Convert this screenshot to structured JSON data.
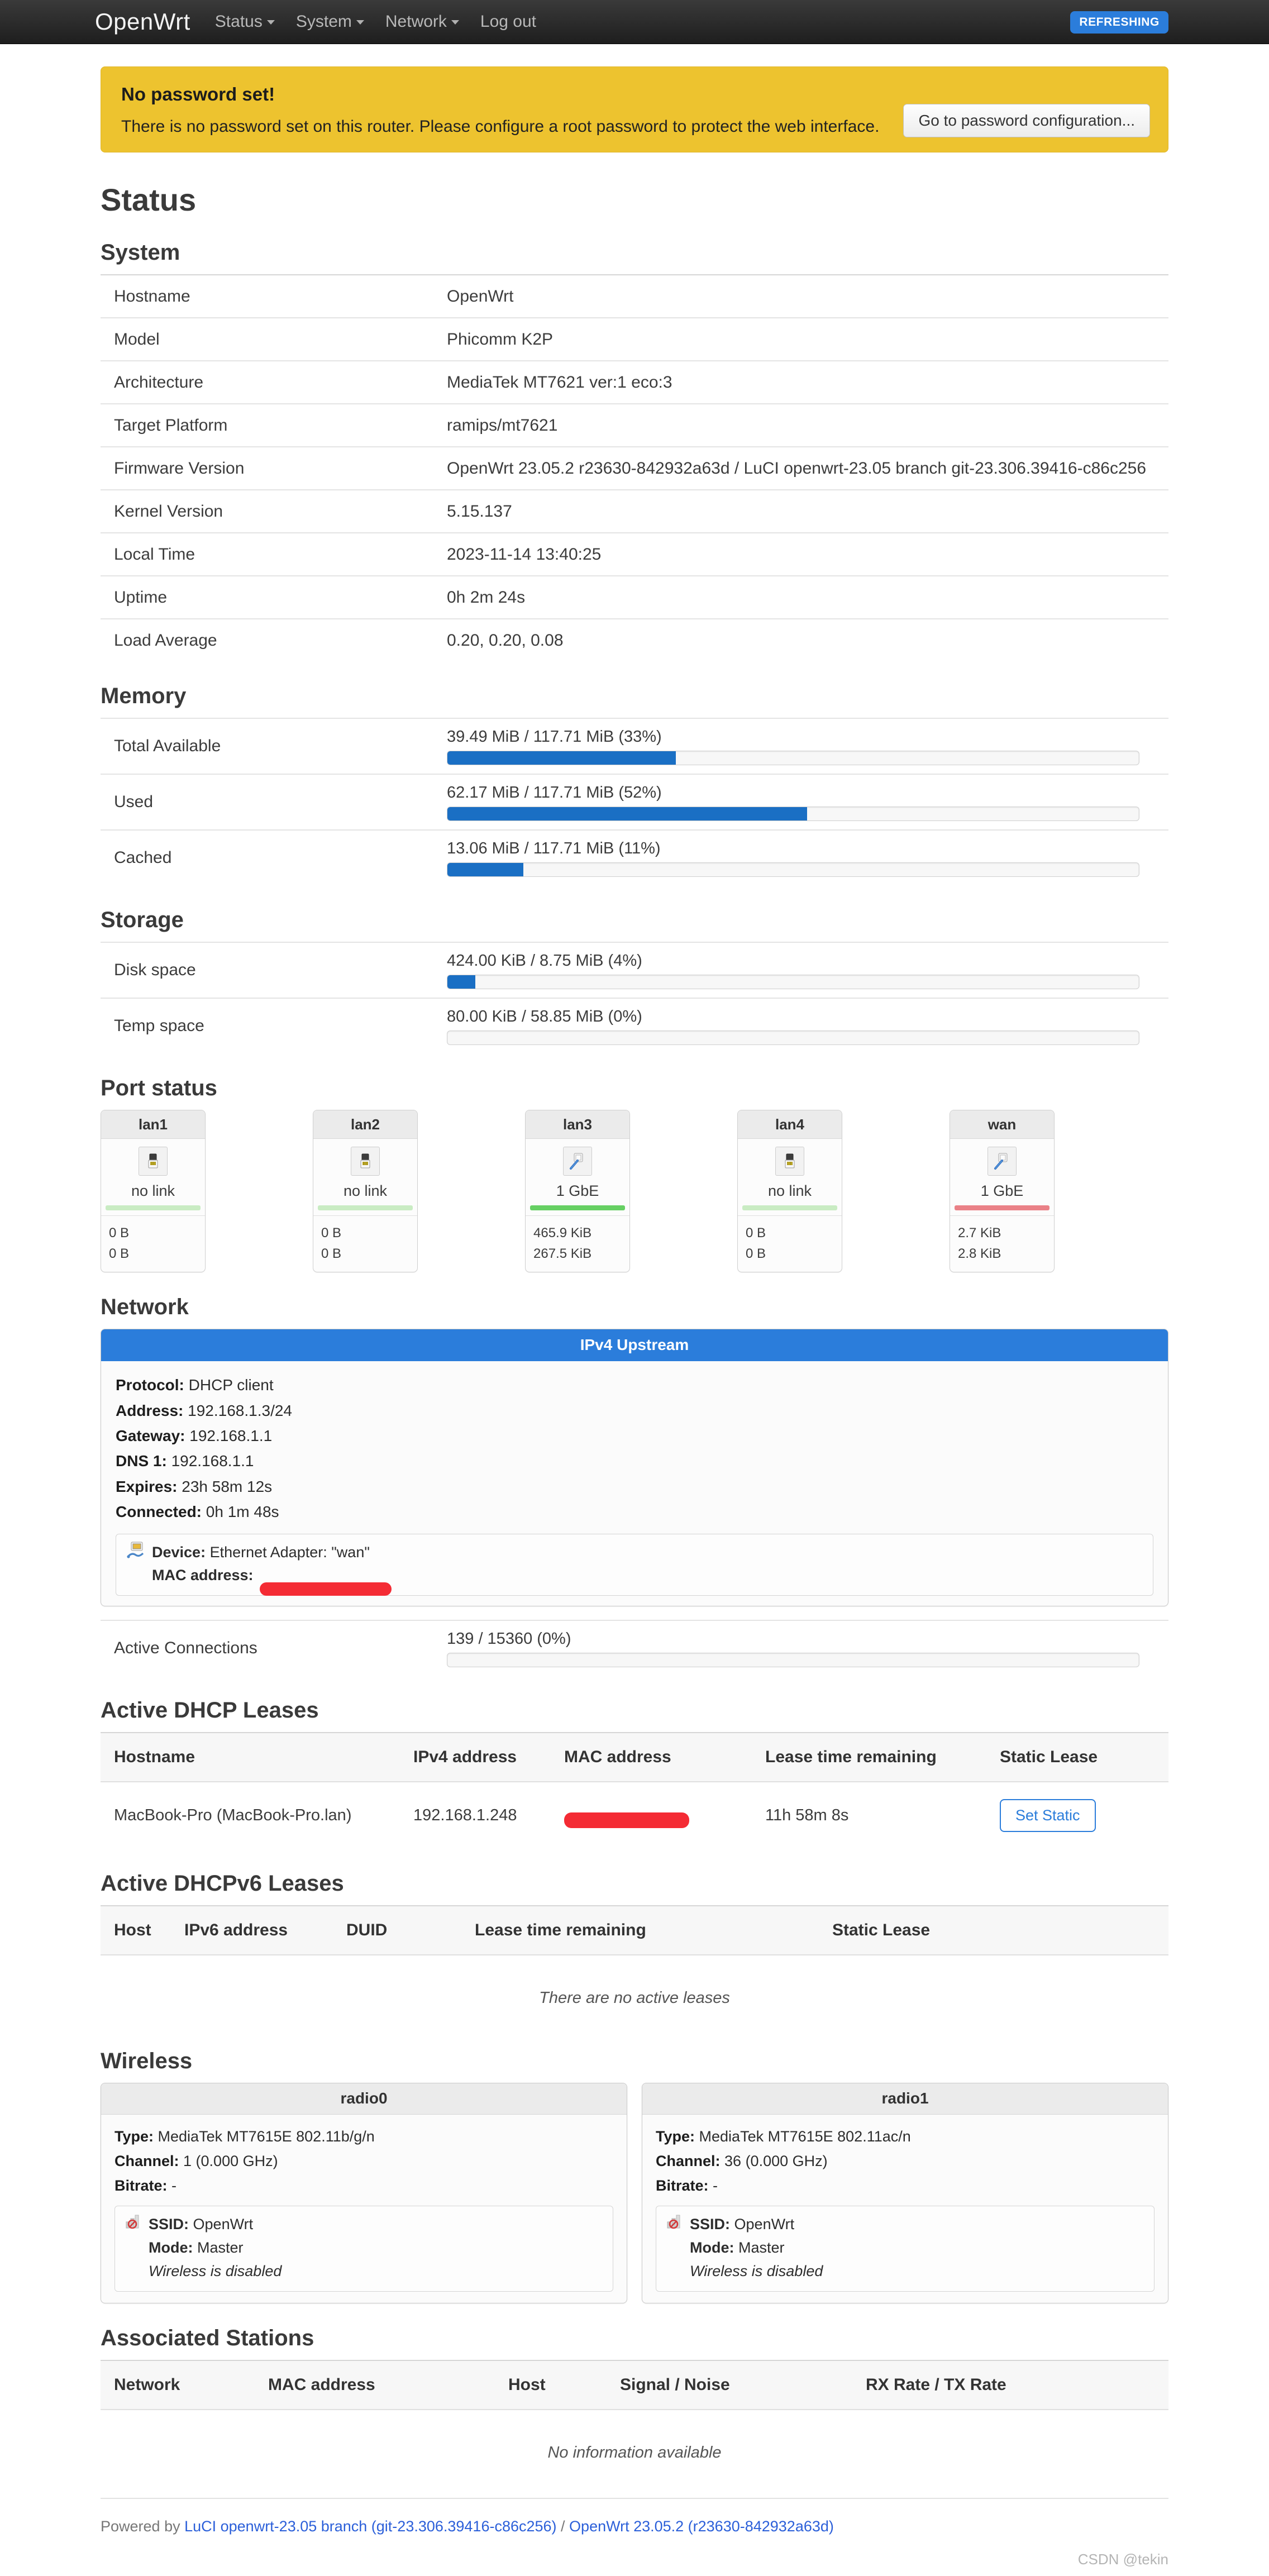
{
  "nav": {
    "brand": "OpenWrt",
    "items": [
      {
        "label": "Status",
        "has_caret": true
      },
      {
        "label": "System",
        "has_caret": true
      },
      {
        "label": "Network",
        "has_caret": true
      },
      {
        "label": "Log out",
        "has_caret": false
      }
    ],
    "refresh_badge": "REFRESHING",
    "badge_color": "#2b7ddb"
  },
  "alert": {
    "title": "No password set!",
    "text": "There is no password set on this router. Please configure a root password to protect the web interface.",
    "button": "Go to password configuration...",
    "bg_color": "#edc32f"
  },
  "page_title": "Status",
  "system": {
    "heading": "System",
    "rows": [
      {
        "key": "Hostname",
        "value": "OpenWrt"
      },
      {
        "key": "Model",
        "value": "Phicomm K2P"
      },
      {
        "key": "Architecture",
        "value": "MediaTek MT7621 ver:1 eco:3"
      },
      {
        "key": "Target Platform",
        "value": "ramips/mt7621"
      },
      {
        "key": "Firmware Version",
        "value": "OpenWrt 23.05.2 r23630-842932a63d / LuCI openwrt-23.05 branch git-23.306.39416-c86c256"
      },
      {
        "key": "Kernel Version",
        "value": "5.15.137"
      },
      {
        "key": "Local Time",
        "value": "2023-11-14 13:40:25"
      },
      {
        "key": "Uptime",
        "value": "0h 2m 24s"
      },
      {
        "key": "Load Average",
        "value": "0.20, 0.20, 0.08"
      }
    ]
  },
  "memory": {
    "heading": "Memory",
    "rows": [
      {
        "key": "Total Available",
        "label": "39.49 MiB / 117.71 MiB (33%)",
        "percent": 33
      },
      {
        "key": "Used",
        "label": "62.17 MiB / 117.71 MiB (52%)",
        "percent": 52
      },
      {
        "key": "Cached",
        "label": "13.06 MiB / 117.71 MiB (11%)",
        "percent": 11
      }
    ]
  },
  "storage": {
    "heading": "Storage",
    "rows": [
      {
        "key": "Disk space",
        "label": "424.00 KiB / 8.75 MiB (4%)",
        "percent": 4
      },
      {
        "key": "Temp space",
        "label": "80.00 KiB / 58.85 MiB (0%)",
        "percent": 0
      }
    ]
  },
  "port_status": {
    "heading": "Port status",
    "ports": [
      {
        "name": "lan1",
        "speed": "no link",
        "linked": false,
        "accent": "#c9ecc3",
        "rx": "0 B",
        "tx": "0 B"
      },
      {
        "name": "lan2",
        "speed": "no link",
        "linked": false,
        "accent": "#c9ecc3",
        "rx": "0 B",
        "tx": "0 B"
      },
      {
        "name": "lan3",
        "speed": "1 GbE",
        "linked": true,
        "accent": "#66d063",
        "rx": "465.9 KiB",
        "tx": "267.5 KiB"
      },
      {
        "name": "lan4",
        "speed": "no link",
        "linked": false,
        "accent": "#c9ecc3",
        "rx": "0 B",
        "tx": "0 B"
      },
      {
        "name": "wan",
        "speed": "1 GbE",
        "linked": true,
        "accent": "#ea8187",
        "rx": "2.7 KiB",
        "tx": "2.8 KiB"
      }
    ]
  },
  "network": {
    "heading": "Network",
    "upstream": {
      "title": "IPv4 Upstream",
      "title_bg": "#2b7ddb",
      "lines": [
        {
          "label": "Protocol:",
          "value": "DHCP client"
        },
        {
          "label": "Address:",
          "value": "192.168.1.3/24"
        },
        {
          "label": "Gateway:",
          "value": "192.168.1.1"
        },
        {
          "label": "DNS 1:",
          "value": "192.168.1.1"
        },
        {
          "label": "Expires:",
          "value": "23h 58m 12s"
        },
        {
          "label": "Connected:",
          "value": "0h 1m 48s"
        }
      ],
      "device_label": "Device:",
      "device_value": "Ethernet Adapter: \"wan\"",
      "mac_label": "MAC address:",
      "mac_value": "",
      "mac_redacted": true
    },
    "active_connections": {
      "key": "Active Connections",
      "label": "139 / 15360 (0%)",
      "percent": 0
    }
  },
  "dhcp_leases": {
    "heading": "Active DHCP Leases",
    "columns": [
      "Hostname",
      "IPv4 address",
      "MAC address",
      "Lease time remaining",
      "Static Lease"
    ],
    "rows": [
      {
        "hostname": "MacBook-Pro (MacBook-Pro.lan)",
        "ipv4": "192.168.1.248",
        "mac": "",
        "mac_redacted": true,
        "lease": "11h 58m 8s",
        "action": "Set Static"
      }
    ]
  },
  "dhcpv6_leases": {
    "heading": "Active DHCPv6 Leases",
    "columns": [
      "Host",
      "IPv6 address",
      "DUID",
      "Lease time remaining",
      "Static Lease"
    ],
    "empty_text": "There are no active leases"
  },
  "wireless": {
    "heading": "Wireless",
    "radios": [
      {
        "name": "radio0",
        "type_label": "Type:",
        "type_value": "MediaTek MT7615E 802.11b/g/n",
        "channel_label": "Channel:",
        "channel_value": "1 (0.000 GHz)",
        "bitrate_label": "Bitrate:",
        "bitrate_value": "-",
        "ssid_label": "SSID:",
        "ssid_value": "OpenWrt",
        "mode_label": "Mode:",
        "mode_value": "Master",
        "status": "Wireless is disabled"
      },
      {
        "name": "radio1",
        "type_label": "Type:",
        "type_value": "MediaTek MT7615E 802.11ac/n",
        "channel_label": "Channel:",
        "channel_value": "36 (0.000 GHz)",
        "bitrate_label": "Bitrate:",
        "bitrate_value": "-",
        "ssid_label": "SSID:",
        "ssid_value": "OpenWrt",
        "mode_label": "Mode:",
        "mode_value": "Master",
        "status": "Wireless is disabled"
      }
    ]
  },
  "associated_stations": {
    "heading": "Associated Stations",
    "columns": [
      "Network",
      "MAC address",
      "Host",
      "Signal / Noise",
      "RX Rate / TX Rate"
    ],
    "empty_text": "No information available"
  },
  "footer": {
    "prefix": "Powered by ",
    "link1": "LuCI openwrt-23.05 branch (git-23.306.39416-c86c256)",
    "sep": " / ",
    "link2": "OpenWrt 23.05.2 (r23630-842932a63d)"
  },
  "watermark": "CSDN @tekin"
}
